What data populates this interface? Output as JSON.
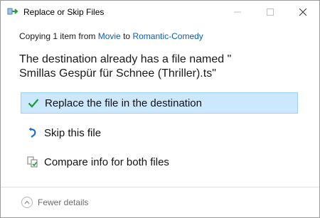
{
  "window": {
    "title": "Replace or Skip Files",
    "icons": {
      "app": "copy-arrow-icon",
      "minimize": "minimize-icon",
      "maximize": "maximize-icon",
      "close": "close-icon"
    }
  },
  "copying": {
    "prefix": "Copying 1 item from",
    "source": "Movie",
    "to_word": "to",
    "destination": "Romantic-Comedy"
  },
  "message": {
    "line1": "The destination already has a file named \"",
    "line2": "Smillas Gespür für Schnee (Thriller).ts\""
  },
  "options": [
    {
      "label": "Replace the file in the destination",
      "icon": "checkmark-icon",
      "selected": true
    },
    {
      "label": "Skip this file",
      "icon": "skip-arrow-icon",
      "selected": false
    },
    {
      "label": "Compare info for both files",
      "icon": "compare-files-icon",
      "selected": false
    }
  ],
  "footer": {
    "fewer_details": "Fewer details",
    "icon": "chevron-up-icon"
  },
  "colors": {
    "link": "#0a5fb4",
    "selection_bg": "#cce8ff",
    "selection_border": "#99d1ff",
    "check_green": "#1e9e3c",
    "skip_blue": "#1a6fd1"
  }
}
